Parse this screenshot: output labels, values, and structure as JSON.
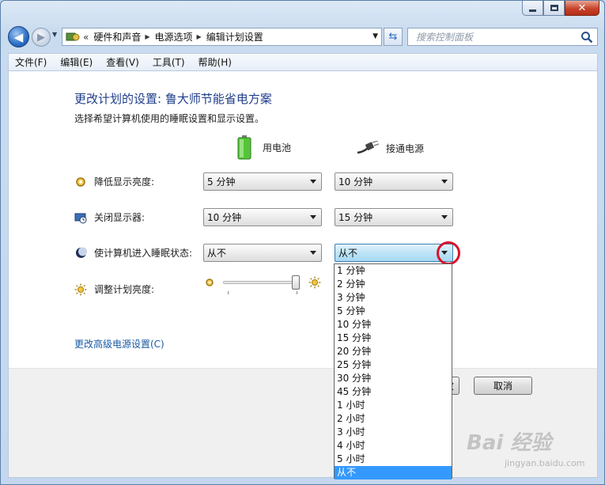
{
  "window": {
    "caption": {
      "minimize": "_",
      "maximize": "□",
      "close": "✕"
    }
  },
  "nav": {
    "back_glyph": "◀",
    "forward_glyph": "▶",
    "address_prefix": "«",
    "breadcrumbs": [
      "硬件和声音",
      "电源选项",
      "编辑计划设置"
    ],
    "search_placeholder": "搜索控制面板"
  },
  "menu": [
    "文件(F)",
    "编辑(E)",
    "查看(V)",
    "工具(T)",
    "帮助(H)"
  ],
  "page": {
    "title": "更改计划的设置: 鲁大师节能省电方案",
    "subtitle": "选择希望计算机使用的睡眠设置和显示设置。",
    "column_battery": "用电池",
    "column_plugged": "接通电源",
    "settings": [
      {
        "label": "降低显示亮度:",
        "battery": "5 分钟",
        "plugged": "10 分钟"
      },
      {
        "label": "关闭显示器:",
        "battery": "10 分钟",
        "plugged": "15 分钟"
      },
      {
        "label": "使计算机进入睡眠状态:",
        "battery": "从不",
        "plugged": "从不"
      }
    ],
    "brightness_label": "调整计划亮度:",
    "brightness_level_fraction": 0.98,
    "advanced_link": "更改高级电源设置(C)",
    "save_button_partial": "改",
    "cancel_button": "取消"
  },
  "dropdown": {
    "options": [
      "1 分钟",
      "2 分钟",
      "3 分钟",
      "5 分钟",
      "10 分钟",
      "15 分钟",
      "20 分钟",
      "25 分钟",
      "30 分钟",
      "45 分钟",
      "1 小时",
      "2 小时",
      "3 小时",
      "4 小时",
      "5 小时",
      "从不"
    ],
    "selected_index": 15
  },
  "watermark": {
    "main": "Bai 经验",
    "sub": "jingyan.baidu.com"
  },
  "colors": {
    "title": "#1f3d8a",
    "link": "#1a5aa5",
    "selection": "#3399ff",
    "highlight_ring": "#d8142c"
  }
}
